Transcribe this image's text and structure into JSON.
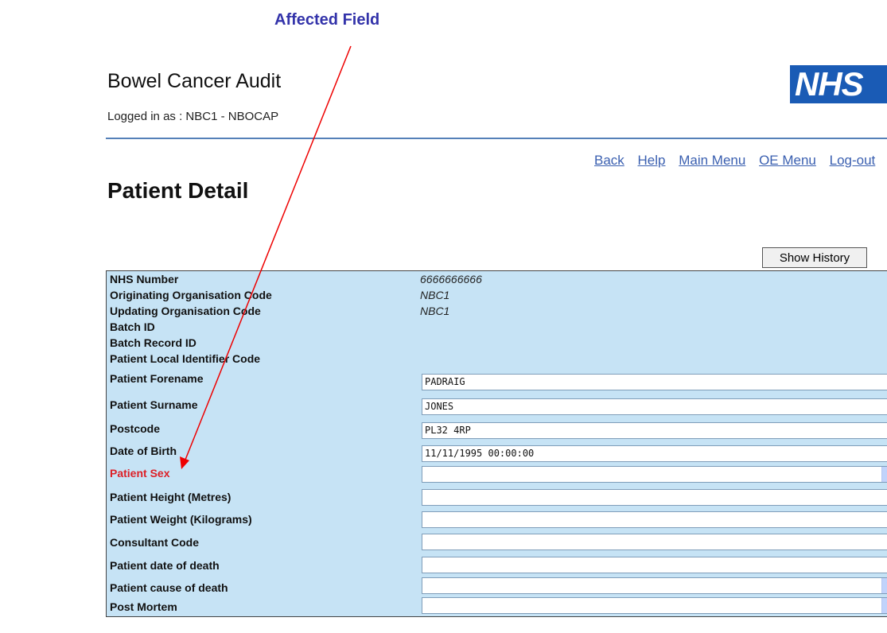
{
  "annotation": {
    "label": "Affected Field"
  },
  "header": {
    "title": "Bowel Cancer Audit",
    "login_info": "Logged in as : NBC1 - NBOCAP",
    "logo_text": "NHS",
    "brand_color": "#1a5bb5"
  },
  "nav": {
    "links": [
      "Back",
      "Help",
      "Main Menu",
      "OE Menu",
      "Log-out"
    ],
    "link_color": "#3a5fb0"
  },
  "page": {
    "title": "Patient Detail",
    "show_history_label": "Show History"
  },
  "panel_color": "#c6e3f5",
  "error_color": "#dd1f26",
  "readonly_fields": [
    {
      "label": "NHS Number",
      "value": "6666666666"
    },
    {
      "label": "Originating Organisation Code",
      "value": "NBC1"
    },
    {
      "label": "Updating Organisation Code",
      "value": "NBC1"
    },
    {
      "label": "Batch ID",
      "value": ""
    },
    {
      "label": "Batch Record ID",
      "value": ""
    },
    {
      "label": "Patient Local Identifier Code",
      "value": ""
    }
  ],
  "input_fields": [
    {
      "label": "Patient Forename",
      "value": "PADRAIG",
      "type": "text"
    },
    {
      "label": "Patient Surname",
      "value": "JONES",
      "type": "text"
    },
    {
      "label": "Postcode",
      "value": "PL32 4RP",
      "type": "text"
    },
    {
      "label": "Date of Birth",
      "value": "11/11/1995 00:00:00",
      "type": "text"
    },
    {
      "label": "Patient Sex",
      "value": "",
      "type": "select",
      "error": true
    },
    {
      "label": "Patient Height (Metres)",
      "value": "",
      "type": "text"
    },
    {
      "label": "Patient Weight (Kilograms)",
      "value": "",
      "type": "text"
    },
    {
      "label": "Consultant Code",
      "value": "",
      "type": "text"
    },
    {
      "label": "Patient date of death",
      "value": "",
      "type": "text"
    },
    {
      "label": "Patient cause of death",
      "value": "",
      "type": "select"
    },
    {
      "label": "Post Mortem",
      "value": "",
      "type": "select"
    }
  ]
}
